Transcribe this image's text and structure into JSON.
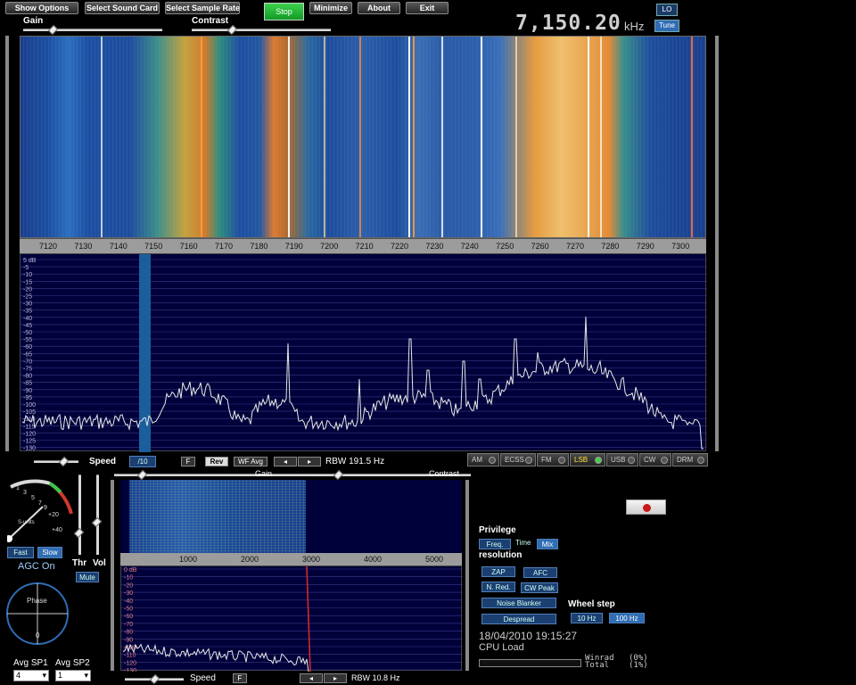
{
  "menu": {
    "show_options": "Show Options",
    "select_sound_card": "Select Sound Card",
    "select_sample_rate": "Select Sample Rate",
    "stop": "Stop",
    "minimize": "Minimize",
    "about": "About",
    "exit": "Exit"
  },
  "controls": {
    "gain": "Gain",
    "contrast": "Contrast"
  },
  "frequency": {
    "value": "7,150.20",
    "unit": "kHz",
    "lo": "LO",
    "tune": "Tune"
  },
  "main_axis": {
    "ticks": [
      "7120",
      "7130",
      "7140",
      "7150",
      "7160",
      "7170",
      "7180",
      "7190",
      "7200",
      "7210",
      "7220",
      "7230",
      "7240",
      "7250",
      "7260",
      "7270",
      "7280",
      "7290",
      "7300"
    ]
  },
  "db_scale": [
    "5 dB",
    "-5",
    "-10",
    "-15",
    "-20",
    "-25",
    "-30",
    "-35",
    "-40",
    "-45",
    "-50",
    "-55",
    "-60",
    "-65",
    "-70",
    "-75",
    "-80",
    "-85",
    "-90",
    "-95",
    "-100",
    "-105",
    "-110",
    "-115",
    "-120",
    "-125",
    "-130"
  ],
  "mid_controls": {
    "speed": "Speed",
    "speed_val": "/10",
    "f": "F",
    "rev": "Rev",
    "wf_avg": "WF Avg",
    "rbw": "RBW 191.5 Hz",
    "sub_gain": "Gain",
    "sub_contrast": "Contrast"
  },
  "modes": [
    "AM",
    "ECSS",
    "FM",
    "LSB",
    "USB",
    "CW",
    "DRM"
  ],
  "active_mode": "LSB",
  "agc": {
    "s_units": "S-units",
    "scale": [
      "1",
      "3",
      "5",
      "7",
      "9",
      "+20",
      "+40"
    ],
    "fast": "Fast",
    "slow": "Slow",
    "agc_on": "AGC On",
    "thr": "Thr",
    "vol": "Vol",
    "mute": "Mute",
    "phase": "Phase",
    "phase_zero": "0",
    "avg_sp1": "Avg SP1",
    "avg_sp2": "Avg SP2",
    "avg_sp1_val": "4",
    "avg_sp2_val": "1"
  },
  "sub_axis": {
    "ticks": [
      "1000",
      "2000",
      "3000",
      "4000",
      "5000"
    ]
  },
  "sub_db": [
    "0 dB",
    "-10",
    "-20",
    "-30",
    "-40",
    "-50",
    "-60",
    "-70",
    "-80",
    "-90",
    "-100",
    "-110",
    "-120",
    "-130"
  ],
  "sub_bottom": {
    "speed": "Speed",
    "f": "F",
    "rbw": "RBW 10.8 Hz"
  },
  "right_panel": {
    "privilege": "Privilege",
    "freq": "Freq.",
    "time": "Time",
    "mix": "Mix",
    "resolution": "resolution",
    "zap": "ZAP",
    "afc": "AFC",
    "nred": "N. Red.",
    "cwpeak": "CW Peak",
    "noise_blanker": "Noise Blanker",
    "despread": "Despread",
    "wheel_step": "Wheel step",
    "step_10": "10 Hz",
    "step_100": "100 Hz",
    "datetime": "18/04/2010 19:15:27",
    "cpu_load": "CPU Load",
    "winrad_label": "Winrad",
    "winrad_val": "(0%)",
    "total_label": "Total",
    "total_val": "(1%)"
  },
  "colors": {
    "accent": "#2f6db4",
    "active_mode": "#ffe23a",
    "stop": "#1fb533",
    "spectrum_bg": "#00003a"
  }
}
